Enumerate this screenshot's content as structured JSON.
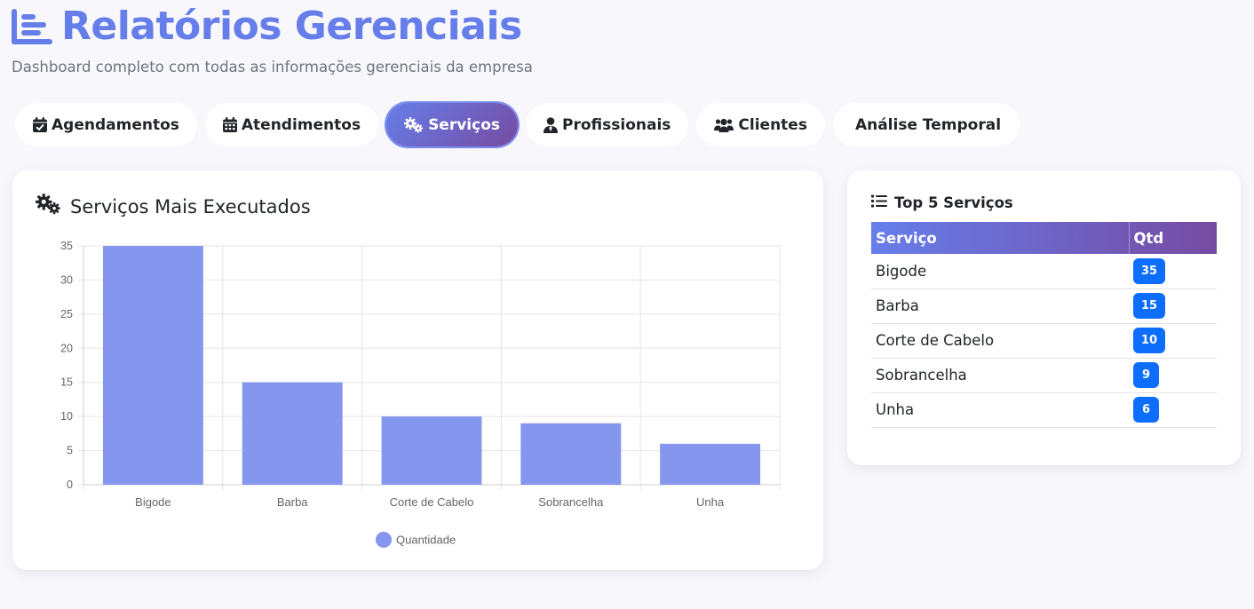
{
  "header": {
    "title": "Relatórios Gerenciais",
    "subtitle": "Dashboard completo com todas as informações gerenciais da empresa",
    "icon": "chart-bars-icon",
    "accent_color": "#667eea"
  },
  "tabs": [
    {
      "label": "Agendamentos",
      "icon": "calendar-check-icon",
      "active": false
    },
    {
      "label": "Atendimentos",
      "icon": "calendar-grid-icon",
      "active": false
    },
    {
      "label": "Serviços",
      "icon": "cogs-icon",
      "active": true
    },
    {
      "label": "Profissionais",
      "icon": "user-tie-icon",
      "active": false
    },
    {
      "label": "Clientes",
      "icon": "users-icon",
      "active": false
    },
    {
      "label": "Análise Temporal",
      "icon": "",
      "active": false
    }
  ],
  "chart_card": {
    "title": "Serviços Mais Executados",
    "icon": "cogs-icon"
  },
  "chart_data": {
    "type": "bar",
    "categories": [
      "Bigode",
      "Barba",
      "Corte de Cabelo",
      "Sobrancelha",
      "Unha"
    ],
    "series": [
      {
        "name": "Quantidade",
        "values": [
          35,
          15,
          10,
          9,
          6
        ],
        "color": "#8496ed"
      }
    ],
    "title": "Serviços Mais Executados",
    "ylim": [
      0,
      35
    ],
    "yticks": [
      0,
      5,
      10,
      15,
      20,
      25,
      30,
      35
    ],
    "grid": true,
    "legend": "bottom"
  },
  "table_card": {
    "title": "Top 5 Serviços",
    "icon": "list-icon",
    "columns": [
      "Serviço",
      "Qtd"
    ],
    "rows": [
      {
        "name": "Bigode",
        "qty": "35"
      },
      {
        "name": "Barba",
        "qty": "15"
      },
      {
        "name": "Corte de Cabelo",
        "qty": "10"
      },
      {
        "name": "Sobrancelha",
        "qty": "9"
      },
      {
        "name": "Unha",
        "qty": "6"
      }
    ],
    "badge_color": "#0d6efd"
  }
}
